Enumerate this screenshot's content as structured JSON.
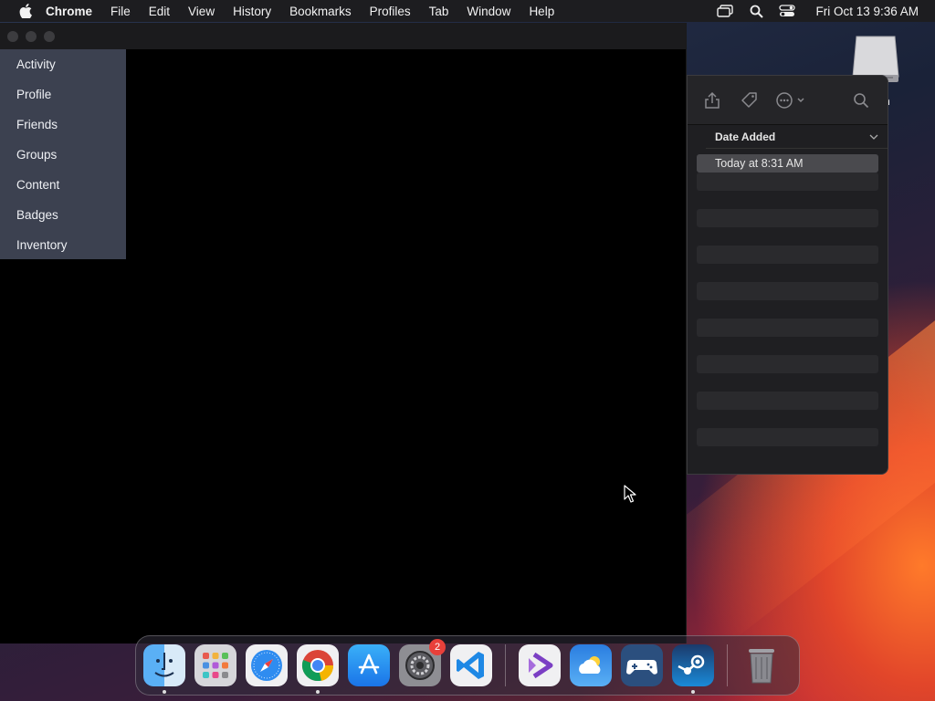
{
  "menubar": {
    "app_name": "Chrome",
    "items": [
      "File",
      "Edit",
      "View",
      "History",
      "Bookmarks",
      "Profiles",
      "Tab",
      "Window",
      "Help"
    ],
    "clock": "Fri Oct 13  9:36 AM"
  },
  "desktop": {
    "drive_label": "n"
  },
  "sidebar": {
    "items": [
      {
        "label": "Activity"
      },
      {
        "label": "Profile"
      },
      {
        "label": "Friends"
      },
      {
        "label": "Groups"
      },
      {
        "label": "Content"
      },
      {
        "label": "Badges"
      },
      {
        "label": "Inventory"
      }
    ]
  },
  "finder": {
    "column_header": "Date Added",
    "rows": [
      {
        "date_added": "Today at 8:31 AM",
        "selected": true
      },
      {
        "date_added": ""
      },
      {
        "date_added": ""
      },
      {
        "date_added": ""
      },
      {
        "date_added": ""
      },
      {
        "date_added": ""
      },
      {
        "date_added": ""
      },
      {
        "date_added": ""
      },
      {
        "date_added": ""
      },
      {
        "date_added": ""
      },
      {
        "date_added": ""
      },
      {
        "date_added": ""
      },
      {
        "date_added": ""
      },
      {
        "date_added": ""
      },
      {
        "date_added": ""
      },
      {
        "date_added": ""
      }
    ]
  },
  "dock": {
    "apps": [
      {
        "name": "Finder",
        "icon": "finder-icon",
        "running": true
      },
      {
        "name": "Launchpad",
        "icon": "launchpad-icon"
      },
      {
        "name": "Safari",
        "icon": "safari-icon"
      },
      {
        "name": "Chrome",
        "icon": "chrome-icon",
        "running": true
      },
      {
        "name": "App Store",
        "icon": "app-store-icon"
      },
      {
        "name": "System Settings",
        "icon": "settings-icon",
        "badge": "2"
      },
      {
        "name": "Visual Studio Code",
        "icon": "vscode-icon"
      },
      {
        "name": "Visual Studio",
        "icon": "visual-studio-icon"
      },
      {
        "name": "Weather",
        "icon": "weather-icon"
      },
      {
        "name": "Game Controller",
        "icon": "gamepad-icon"
      },
      {
        "name": "Steam",
        "icon": "steam-icon",
        "running": true
      },
      {
        "name": "Trash",
        "icon": "trash-icon"
      }
    ]
  }
}
